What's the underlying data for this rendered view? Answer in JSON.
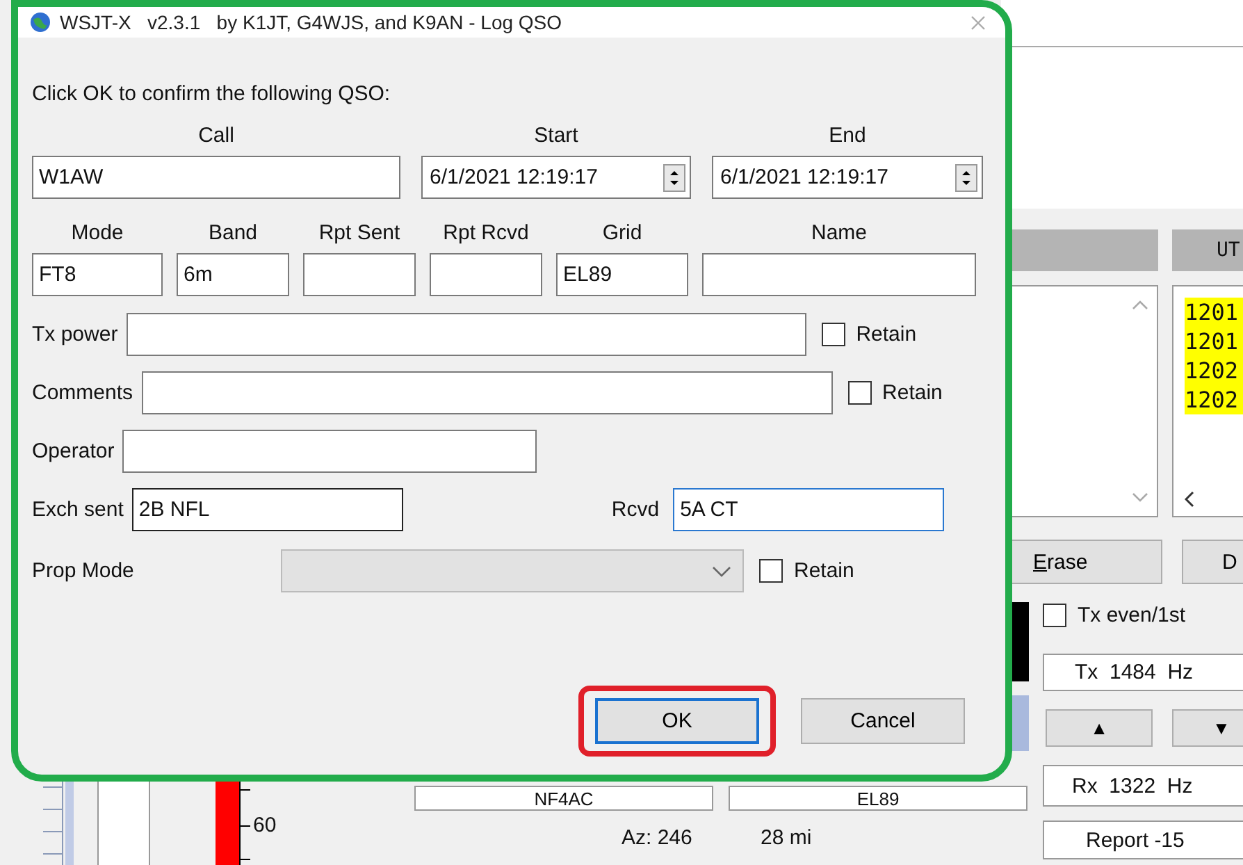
{
  "dialog": {
    "title": "WSJT-X   v2.3.1   by K1JT, G4WJS, and K9AN - Log QSO",
    "prompt": "Click OK to confirm the following QSO:",
    "call": {
      "label": "Call",
      "value": "W1AW"
    },
    "start": {
      "label": "Start",
      "value": "6/1/2021 12:19:17"
    },
    "end": {
      "label": "End",
      "value": "6/1/2021 12:19:17"
    },
    "row_fields": [
      {
        "label": "Mode",
        "value": "FT8"
      },
      {
        "label": "Band",
        "value": "6m"
      },
      {
        "label": "Rpt Sent"
      },
      {
        "label": "Rpt Rcvd"
      },
      {
        "label": "Grid",
        "value": "EL89"
      },
      {
        "label": "Name"
      }
    ],
    "tx_power": {
      "label": "Tx power",
      "retain_label": "Retain",
      "retain": false
    },
    "comments": {
      "label": "Comments",
      "retain_label": "Retain",
      "retain": false
    },
    "operator": {
      "label": "Operator"
    },
    "exch_sent": {
      "label": "Exch sent",
      "value": "2B NFL"
    },
    "rcvd": {
      "label": "Rcvd",
      "value": "5A CT",
      "focused": true
    },
    "prop_mode": {
      "label": "Prop Mode",
      "disabled": true,
      "retain_label": "Retain",
      "retain": false
    },
    "buttons": [
      {
        "label": "OK",
        "default": true,
        "highlighted": true
      },
      {
        "label": "Cancel",
        "default": false,
        "highlighted": false
      }
    ]
  },
  "background": {
    "header": "UT",
    "decode_lines": [
      "1201",
      "1201",
      "1202",
      "1202"
    ],
    "erase": "Erase",
    "next_button": "D",
    "tx_even": {
      "label": "Tx even/1st",
      "checked": false
    },
    "tx_freq": "Tx  1484  Hz",
    "up": "▲",
    "down": "▼",
    "rx_freq": "Rx  1322  Hz",
    "report": "Report -15",
    "dx_call": "NF4AC",
    "dx_grid": "EL89",
    "azimuth": "Az: 246",
    "distance": "28 mi",
    "meter_tick": "60"
  }
}
